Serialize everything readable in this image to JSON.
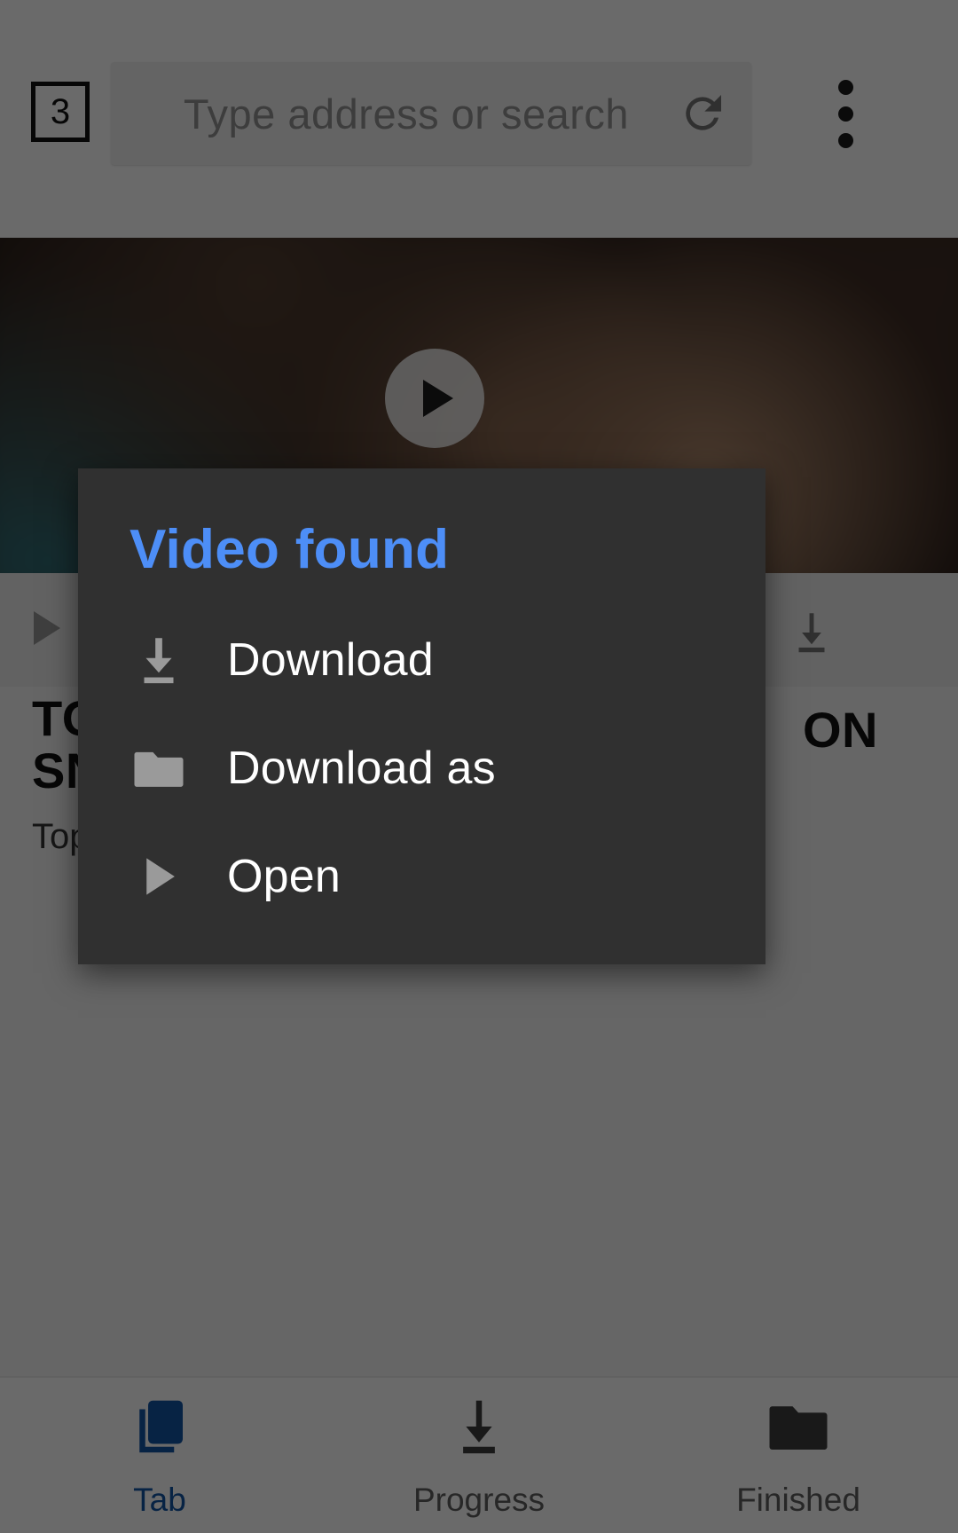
{
  "browser": {
    "tab_count": "3",
    "address_placeholder": "Type address or search",
    "address_value": "",
    "reload_icon": "refresh-icon",
    "overflow_icon": "overflow-menu-icon"
  },
  "hero": {
    "play_icon": "play-button-icon"
  },
  "page_strip": {
    "play_icon": "play-icon",
    "download_icon": "download-icon"
  },
  "article": {
    "headline": "TO\nSN",
    "headline_right": "ON",
    "subline": "Top"
  },
  "dialog": {
    "title": "Video found",
    "title_color": "#4d8ef7",
    "background_color": "#303030",
    "items": [
      {
        "label": "Download",
        "icon": "download-icon"
      },
      {
        "label": "Download as",
        "icon": "folder-icon"
      },
      {
        "label": "Open",
        "icon": "play-icon"
      }
    ]
  },
  "bottom_nav": {
    "active_color": "#12509c",
    "items": [
      {
        "label": "Tab",
        "icon": "tabs-icon",
        "active": true
      },
      {
        "label": "Progress",
        "icon": "download-icon",
        "active": false
      },
      {
        "label": "Finished",
        "icon": "folder-icon",
        "active": false
      }
    ]
  }
}
